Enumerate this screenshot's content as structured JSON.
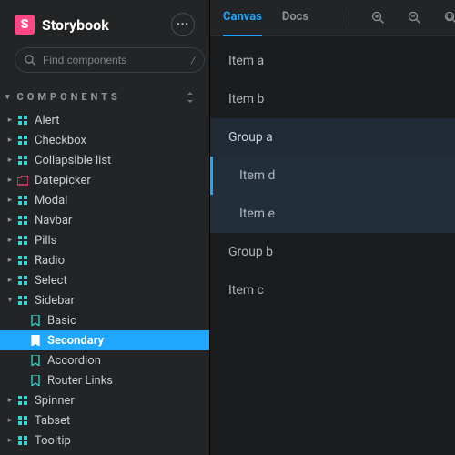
{
  "brand": {
    "name": "Storybook",
    "logo_glyph": "S"
  },
  "search": {
    "placeholder": "Find components",
    "shortcut": "/"
  },
  "section": {
    "title": "COMPONENTS"
  },
  "tree": [
    {
      "label": "Alert",
      "kind": "component",
      "expanded": false
    },
    {
      "label": "Checkbox",
      "kind": "component",
      "expanded": false
    },
    {
      "label": "Collapsible list",
      "kind": "component",
      "expanded": false
    },
    {
      "label": "Datepicker",
      "kind": "folder",
      "expanded": false
    },
    {
      "label": "Modal",
      "kind": "component",
      "expanded": false
    },
    {
      "label": "Navbar",
      "kind": "component",
      "expanded": false
    },
    {
      "label": "Pills",
      "kind": "component",
      "expanded": false
    },
    {
      "label": "Radio",
      "kind": "component",
      "expanded": false
    },
    {
      "label": "Select",
      "kind": "component",
      "expanded": false
    },
    {
      "label": "Sidebar",
      "kind": "component",
      "expanded": true,
      "children": [
        {
          "label": "Basic",
          "selected": false
        },
        {
          "label": "Secondary",
          "selected": true
        },
        {
          "label": "Accordion",
          "selected": false
        },
        {
          "label": "Router Links",
          "selected": false
        }
      ]
    },
    {
      "label": "Spinner",
      "kind": "component",
      "expanded": false
    },
    {
      "label": "Tabset",
      "kind": "component",
      "expanded": false
    },
    {
      "label": "Tooltip",
      "kind": "component",
      "expanded": false
    }
  ],
  "toolbar": {
    "tabs": [
      {
        "label": "Canvas",
        "active": true
      },
      {
        "label": "Docs",
        "active": false
      }
    ]
  },
  "preview": {
    "items": [
      {
        "label": "Item a",
        "type": "item"
      },
      {
        "label": "Item b",
        "type": "item"
      },
      {
        "label": "Group a",
        "type": "group",
        "expanded": true
      },
      {
        "label": "Item d",
        "type": "child",
        "selected": true
      },
      {
        "label": "Item e",
        "type": "child",
        "selected": false
      },
      {
        "label": "Group b",
        "type": "group2"
      },
      {
        "label": "Item c",
        "type": "item"
      }
    ]
  },
  "colors": {
    "accent": "#1ea7fd",
    "brand": "#ff4785"
  }
}
